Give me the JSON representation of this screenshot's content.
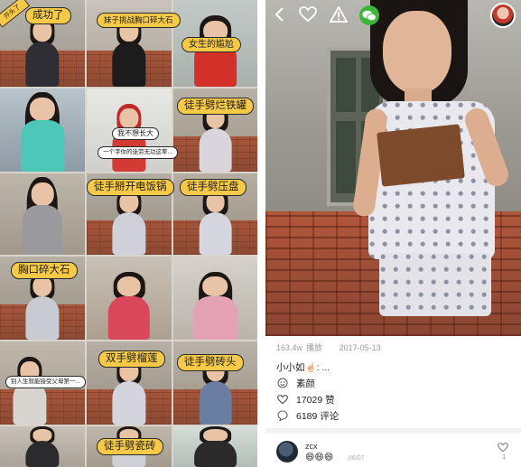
{
  "collage": {
    "corner_banner": "开头了",
    "captions": [
      "成功了",
      "妹子挑战胸口碎大石",
      "女生的尴尬",
      "徒手劈烂铁罐",
      "我不想长大",
      "一个字你的徒劳无功这辈...",
      "徒手掰开电饭锅",
      "徒手劈压盘",
      "胸口碎大石",
      "双手劈榴莲",
      "徒手劈砖头",
      "别人生就能接受父母第一...",
      "徒手劈瓷砖"
    ]
  },
  "video": {
    "top_icons": [
      "back-chevron-icon",
      "heart-outline-icon",
      "warning-triangle-icon",
      "wechat-icon"
    ],
    "accent_wechat": "#3fb63b"
  },
  "meta": {
    "views": "163.4w",
    "views_label": "播放",
    "date": "2017-05-13"
  },
  "post": {
    "author": "小小如",
    "author_emoji": "☝🏻",
    "ellipsis": "...",
    "tag": "素颜",
    "likes": "17029 赞",
    "comments": "6189 评论"
  },
  "comment": {
    "name": "zcx",
    "text": "😄😄😄",
    "date": "06/07",
    "like_count": "1"
  }
}
